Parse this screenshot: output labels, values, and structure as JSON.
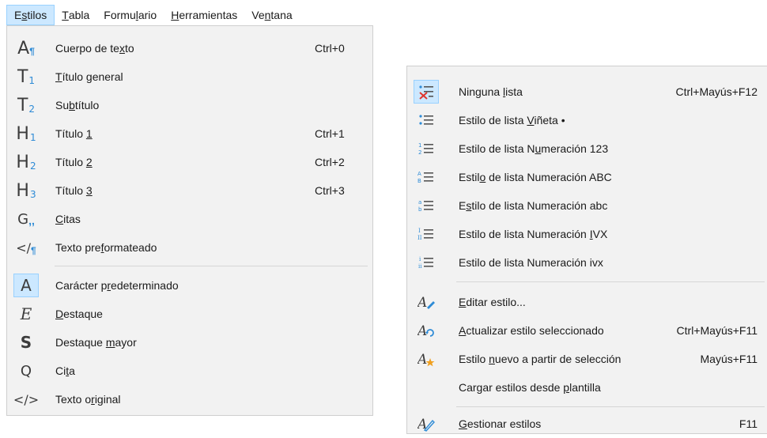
{
  "menubar": {
    "items": [
      {
        "pre": "E",
        "u": "s",
        "post": "tilos"
      },
      {
        "pre": "",
        "u": "T",
        "post": "abla"
      },
      {
        "pre": "Formu",
        "u": "l",
        "post": "ario"
      },
      {
        "pre": "",
        "u": "H",
        "post": "erramientas"
      },
      {
        "pre": "Ve",
        "u": "n",
        "post": "tana"
      }
    ]
  },
  "styles_menu": {
    "items": [
      {
        "pre": "Cuerpo de te",
        "u": "x",
        "post": "to",
        "shortcut": "Ctrl+0",
        "icon": "body-text-icon"
      },
      {
        "pre": "",
        "u": "T",
        "post": "ítulo general",
        "shortcut": "",
        "icon": "title-icon"
      },
      {
        "pre": "Su",
        "u": "b",
        "post": "título",
        "shortcut": "",
        "icon": "subtitle-icon"
      },
      {
        "pre": "Título ",
        "u": "1",
        "post": "",
        "shortcut": "Ctrl+1",
        "icon": "heading-1-icon"
      },
      {
        "pre": "Título ",
        "u": "2",
        "post": "",
        "shortcut": "Ctrl+2",
        "icon": "heading-2-icon"
      },
      {
        "pre": "Título ",
        "u": "3",
        "post": "",
        "shortcut": "Ctrl+3",
        "icon": "heading-3-icon"
      },
      {
        "pre": "",
        "u": "C",
        "post": "itas",
        "shortcut": "",
        "icon": "quotations-icon"
      },
      {
        "pre": "Texto pre",
        "u": "f",
        "post": "ormateado",
        "shortcut": "",
        "icon": "preformatted-text-icon"
      },
      {
        "pre": "Carácter p",
        "u": "r",
        "post": "edeterminado",
        "shortcut": "",
        "icon": "default-character-icon"
      },
      {
        "pre": "",
        "u": "D",
        "post": "estaque",
        "shortcut": "",
        "icon": "emphasis-icon"
      },
      {
        "pre": "Destaque ",
        "u": "m",
        "post": "ayor",
        "shortcut": "",
        "icon": "strong-emphasis-icon"
      },
      {
        "pre": "Ci",
        "u": "t",
        "post": "a",
        "shortcut": "",
        "icon": "quote-icon"
      },
      {
        "pre": "Texto o",
        "u": "r",
        "post": "iginal",
        "shortcut": "",
        "icon": "source-text-icon"
      }
    ]
  },
  "list_menu": {
    "items": [
      {
        "pre": "Ninguna ",
        "u": "l",
        "post": "ista",
        "shortcut": "Ctrl+Mayús+F12",
        "icon": "no-list-icon"
      },
      {
        "pre": "Estilo de lista ",
        "u": "V",
        "post": "iñeta •",
        "shortcut": "",
        "icon": "bullet-list-icon"
      },
      {
        "pre": "Estilo de lista N",
        "u": "u",
        "post": "meración 123",
        "shortcut": "",
        "icon": "number-list-icon"
      },
      {
        "pre": "Estil",
        "u": "o",
        "post": " de lista Numeración ABC",
        "shortcut": "",
        "icon": "alpha-upper-list-icon"
      },
      {
        "pre": "E",
        "u": "s",
        "post": "tilo de lista Numeración abc",
        "shortcut": "",
        "icon": "alpha-lower-list-icon"
      },
      {
        "pre": "Estilo de lista Numeración ",
        "u": "I",
        "post": "VX",
        "shortcut": "",
        "icon": "roman-upper-list-icon"
      },
      {
        "pre": "Estilo de lista Numeración ivx",
        "u": "",
        "post": "",
        "shortcut": "",
        "icon": "roman-lower-list-icon"
      },
      {
        "pre": "",
        "u": "E",
        "post": "ditar estilo...",
        "shortcut": "",
        "icon": "edit-style-icon"
      },
      {
        "pre": "",
        "u": "A",
        "post": "ctualizar estilo seleccionado",
        "shortcut": "Ctrl+Mayús+F11",
        "icon": "update-style-icon"
      },
      {
        "pre": "Estilo ",
        "u": "n",
        "post": "uevo a partir de selección",
        "shortcut": "Mayús+F11",
        "icon": "new-style-icon"
      },
      {
        "pre": "Cargar estilos desde ",
        "u": "p",
        "post": "lantilla",
        "shortcut": "",
        "icon": ""
      },
      {
        "pre": "",
        "u": "G",
        "post": "estionar estilos",
        "shortcut": "F11",
        "icon": "manage-styles-icon"
      }
    ]
  },
  "colors": {
    "accent": "#2e8bd6",
    "highlight": "#cce8ff",
    "highlight_border": "#99d1ff",
    "menu_bg": "#f2f2f2",
    "error_red": "#e0342c",
    "orange": "#f0a020"
  }
}
